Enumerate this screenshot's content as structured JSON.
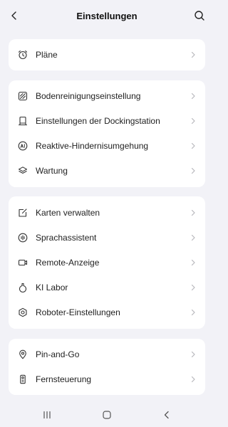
{
  "header": {
    "title": "Einstellungen",
    "back_icon": "chevron-left-icon",
    "search_icon": "search-icon"
  },
  "groups": [
    {
      "items": [
        {
          "label": "Pläne",
          "icon": "alarm-clock-icon"
        }
      ]
    },
    {
      "items": [
        {
          "label": "Bodenreinigungseinstellung",
          "icon": "floor-cleaning-icon"
        },
        {
          "label": "Einstellungen der Dockingstation",
          "icon": "docking-station-icon"
        },
        {
          "label": "Reaktive-Hindernisumgehung",
          "icon": "ai-icon"
        },
        {
          "label": "Wartung",
          "icon": "layers-icon"
        }
      ]
    },
    {
      "items": [
        {
          "label": "Karten verwalten",
          "icon": "map-edit-icon"
        },
        {
          "label": "Sprachassistent",
          "icon": "voice-icon"
        },
        {
          "label": "Remote-Anzeige",
          "icon": "video-icon"
        },
        {
          "label": "KI Labor",
          "icon": "flask-icon"
        },
        {
          "label": "Roboter-Einstellungen",
          "icon": "hexagon-settings-icon"
        }
      ]
    },
    {
      "items": [
        {
          "label": "Pin-and-Go",
          "icon": "location-pin-icon"
        },
        {
          "label": "Fernsteuerung",
          "icon": "remote-control-icon"
        }
      ]
    }
  ],
  "navbar": {
    "recent_icon": "recent-apps-icon",
    "home_icon": "home-icon",
    "back_icon": "back-icon"
  },
  "colors": {
    "background": "#F2F2F7",
    "card": "#FFFFFF",
    "text": "#1F1F1F",
    "chevron": "#B8B8BC"
  }
}
